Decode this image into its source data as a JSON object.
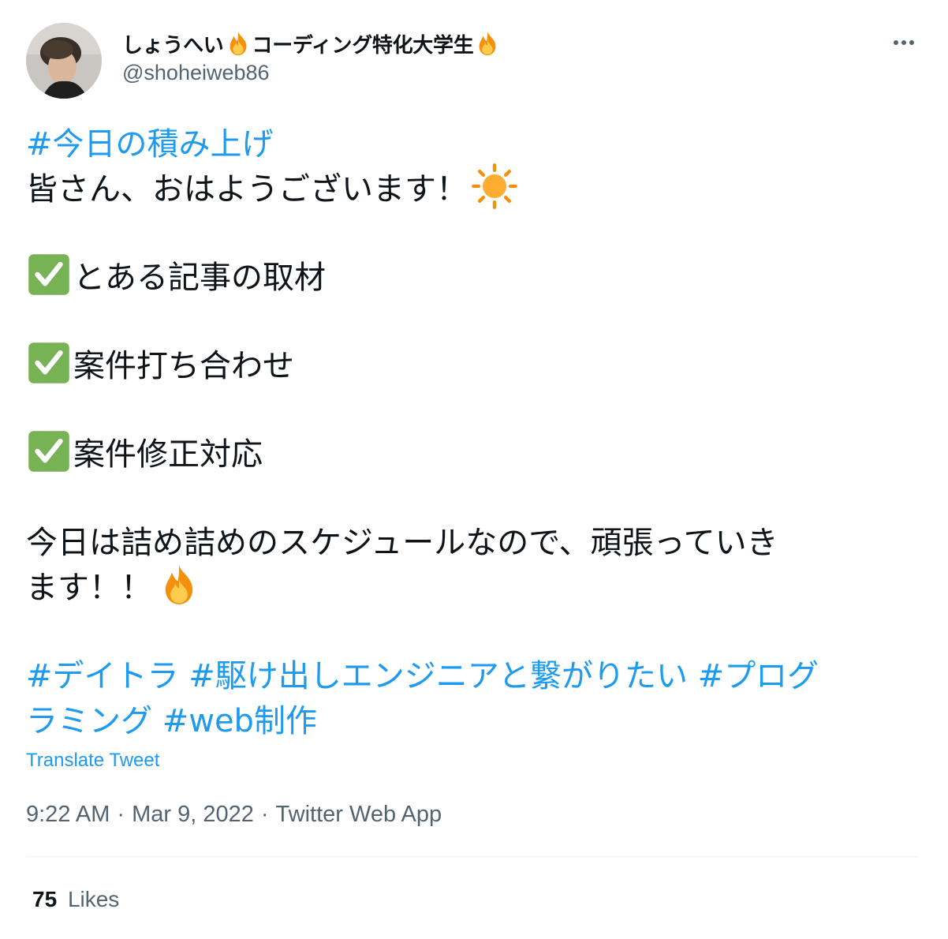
{
  "author": {
    "display_name_part1": "しょうへい",
    "display_name_part2": "コーディング特化大学生",
    "handle": "@shoheiweb86"
  },
  "tweet": {
    "hashtag_top": "#今日の積み上げ",
    "greeting": "皆さん、おはようございます！",
    "tasks": [
      {
        "label": "とある記事の取材",
        "icon": "check-box-icon"
      },
      {
        "label": "案件打ち合わせ",
        "icon": "check-box-icon"
      },
      {
        "label": "案件修正対応",
        "icon": "check-box-icon"
      }
    ],
    "closing_line1": "今日は詰め詰めのスケジュールなので、頑張っていき",
    "closing_line2": "ます！！",
    "hashtags": [
      "#デイトラ",
      "#駆け出しエンジニアと繋がりたい",
      "#プログ",
      "ラミング",
      "#web制作"
    ]
  },
  "translate_label": "Translate Tweet",
  "meta": {
    "time": "9:22 AM",
    "separator": "·",
    "date": "Mar 9, 2022",
    "source": "Twitter Web App"
  },
  "likes": {
    "count": "75",
    "label": "Likes"
  },
  "icons": {
    "name_decoration": "fire-icon",
    "greeting_decoration": "sun-icon",
    "closing_decoration": "fire-icon",
    "menu": "more-options-icon"
  },
  "colors": {
    "link": "#1d9bf0",
    "text": "#0f1419",
    "secondary": "#536471",
    "divider": "#eff3f4",
    "check_green": "#77b255"
  }
}
